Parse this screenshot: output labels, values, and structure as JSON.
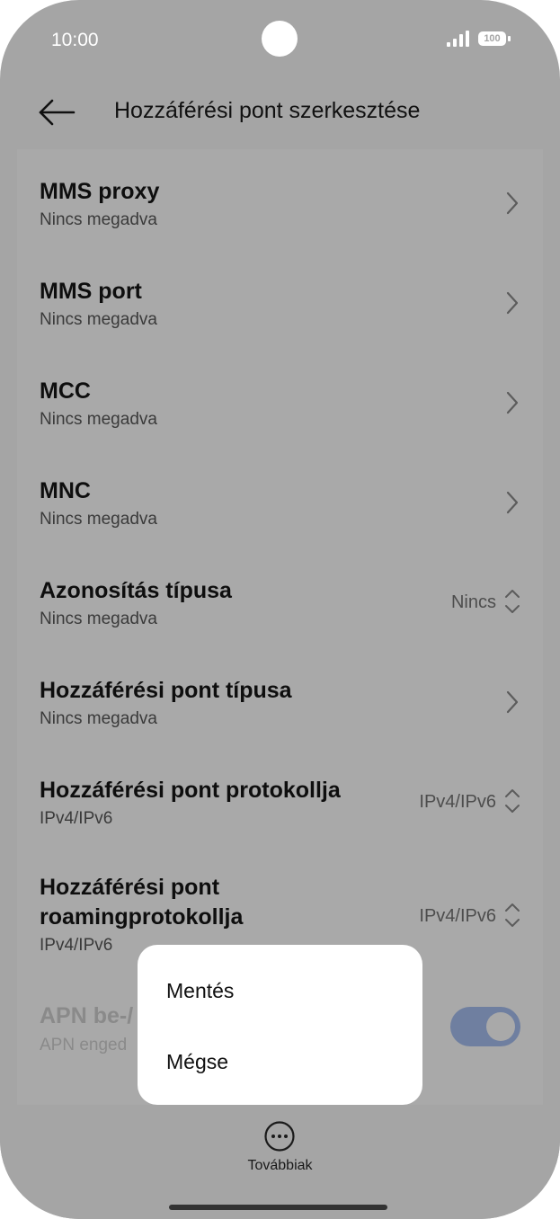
{
  "status_bar": {
    "time": "10:00",
    "battery": "100"
  },
  "header": {
    "title": "Hozzáférési pont szerkesztése"
  },
  "rows": [
    {
      "title": "MMS proxy",
      "subtitle": "Nincs megadva"
    },
    {
      "title": "MMS port",
      "subtitle": "Nincs megadva"
    },
    {
      "title": "MCC",
      "subtitle": "Nincs megadva"
    },
    {
      "title": "MNC",
      "subtitle": "Nincs megadva"
    },
    {
      "title": "Azonosítás típusa",
      "subtitle": "Nincs megadva",
      "value": "Nincs"
    },
    {
      "title": "Hozzáférési pont típusa",
      "subtitle": "Nincs megadva"
    },
    {
      "title": "Hozzáférési pont protokollja",
      "subtitle": "IPv4/IPv6",
      "value": "IPv4/IPv6"
    },
    {
      "title_line1": "Hozzáférési pont",
      "title_line2": "roamingprotokollja",
      "subtitle": "IPv4/IPv6",
      "value": "IPv4/IPv6"
    },
    {
      "title": "APN be-/",
      "subtitle": "APN enged"
    }
  ],
  "popup": {
    "save_label": "Mentés",
    "cancel_label": "Mégse"
  },
  "bottom": {
    "more_label": "Továbbiak"
  },
  "colors": {
    "toggle_on": "#6f7fa0",
    "dim_background": "#a5a5a5"
  }
}
